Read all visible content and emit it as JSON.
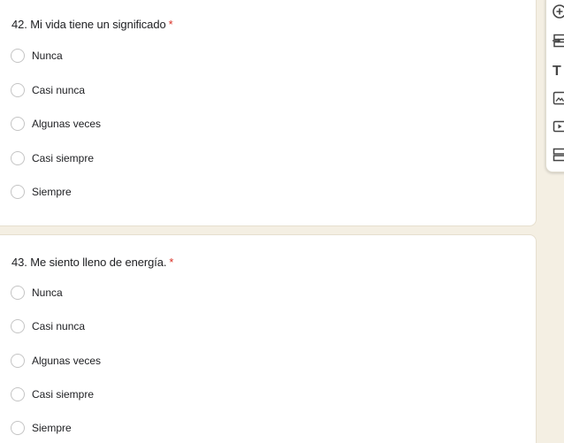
{
  "questions": [
    {
      "title": "42. Mi vida tiene un significado",
      "required_mark": "*",
      "options": [
        "Nunca",
        "Casi nunca",
        "Algunas veces",
        "Casi siempre",
        "Siempre"
      ]
    },
    {
      "title": "43. Me siento lleno de energía.",
      "required_mark": "*",
      "options": [
        "Nunca",
        "Casi nunca",
        "Algunas veces",
        "Casi siempre",
        "Siempre"
      ]
    }
  ],
  "toolbar": {
    "icons": [
      "add-question-icon",
      "import-questions-icon",
      "add-title-icon",
      "add-image-icon",
      "add-video-icon",
      "add-section-icon"
    ],
    "title_glyph": "T"
  },
  "colors": {
    "background": "#f4efe3",
    "required": "#d93025",
    "radio_border": "#c4c4c4"
  }
}
